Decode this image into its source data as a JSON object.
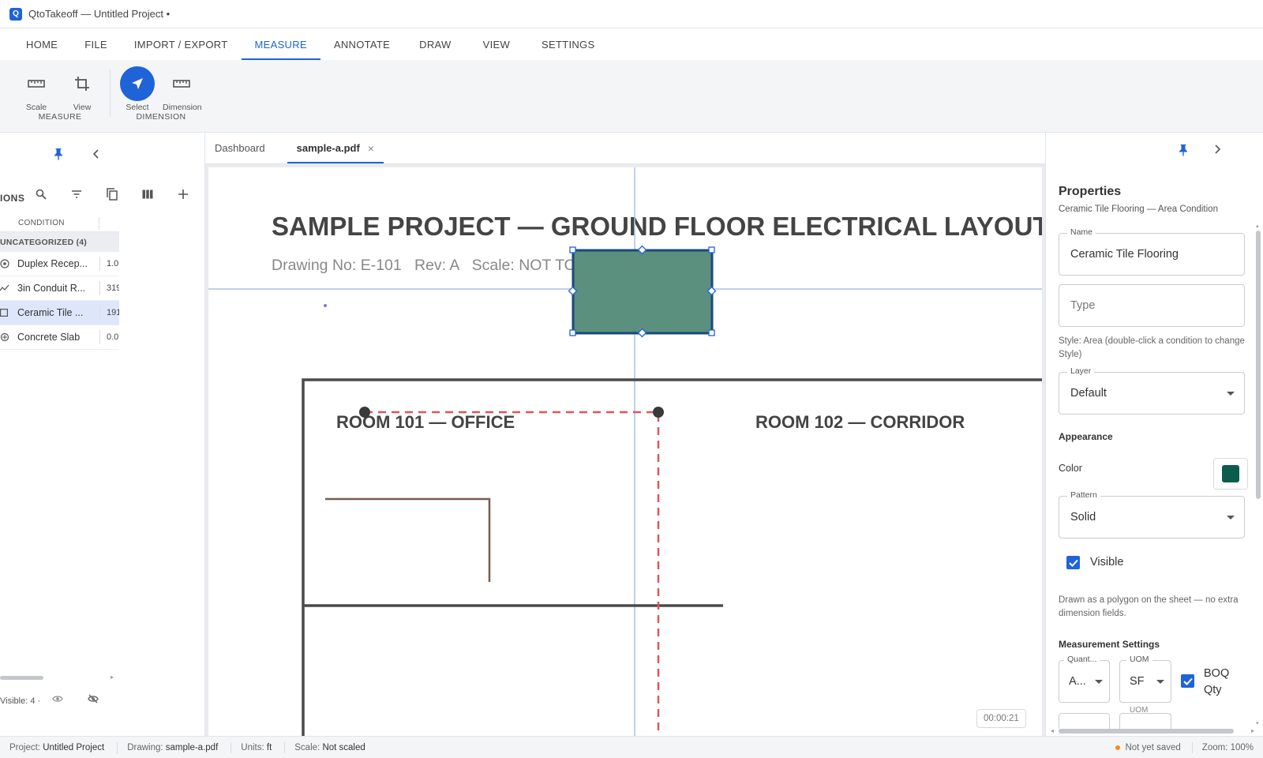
{
  "app": {
    "logo_letter": "Q",
    "window_title": "QtoTakeoff — Untitled Project •"
  },
  "ribbon_tabs": [
    {
      "label": "HOME"
    },
    {
      "label": "FILE"
    },
    {
      "label": "IMPORT / EXPORT"
    },
    {
      "label": "MEASURE",
      "active": true
    },
    {
      "label": "ANNOTATE"
    },
    {
      "label": "DRAW"
    },
    {
      "label": "VIEW"
    },
    {
      "label": "SETTINGS"
    }
  ],
  "ribbon": {
    "groups": [
      {
        "label": "MEASURE",
        "buttons": [
          {
            "label": "Scale",
            "icon": "ruler-icon"
          },
          {
            "label": "View",
            "icon": "crop-icon"
          }
        ]
      },
      {
        "label": "DIMENSION",
        "buttons": [
          {
            "label": "Select",
            "icon": "cursor-arrow-icon",
            "active": true
          },
          {
            "label": "Dimension",
            "icon": "ruler-icon"
          }
        ]
      }
    ]
  },
  "left_panel": {
    "title": "IONS",
    "table_header": "CONDITION",
    "group_label": "UNCATEGORIZED (4)",
    "rows": [
      {
        "name": "Duplex Recep...",
        "qty": "1.0",
        "icon": "count-icon"
      },
      {
        "name": "3in Conduit R...",
        "qty": "319",
        "icon": "linear-icon"
      },
      {
        "name": "Ceramic Tile ...",
        "qty": "191",
        "icon": "area-icon",
        "selected": true
      },
      {
        "name": "Concrete Slab",
        "qty": "0.0",
        "icon": "volume-icon"
      }
    ],
    "footer_text": "Visible: 4 ·"
  },
  "doc_tabs": [
    {
      "label": "Dashboard"
    },
    {
      "label": "sample-a.pdf",
      "active": true,
      "close": "×"
    }
  ],
  "sheet": {
    "title": "SAMPLE PROJECT — GROUND FLOOR ELECTRICAL LAYOUT",
    "subtitle": "Drawing No: E-101   Rev: A   Scale: NOT TO SCALE (sample)",
    "room_101": "ROOM 101 — OFFICE",
    "room_102": "ROOM 102 — CORRIDOR",
    "timer": "00:00:21",
    "area_color": "#5b8f7e",
    "dim_color": "#e05555"
  },
  "properties": {
    "title": "Properties",
    "subtitle": "Ceramic Tile Flooring — Area Condition",
    "name_label": "Name",
    "name_value": "Ceramic Tile Flooring",
    "type_placeholder": "Type",
    "style_note": "Style: Area (double-click a condition to change Style)",
    "layer_label": "Layer",
    "layer_value": "Default",
    "appearance_heading": "Appearance",
    "color_label": "Color",
    "color_value": "#0b5c4c",
    "pattern_label": "Pattern",
    "pattern_value": "Solid",
    "visible_label": "Visible",
    "polygon_note": "Drawn as a polygon on the sheet — no extra dimension fields.",
    "measurement_heading": "Measurement Settings",
    "quantity_label": "Quant...",
    "quantity_value": "A...",
    "uom_label": "UOM",
    "uom_value": "SF",
    "uom_label_2": "UOM",
    "boq_label_1": "BOQ",
    "boq_label_2": "Qty"
  },
  "status": {
    "project_label": "Project:",
    "project_value": "Untitled Project",
    "drawing_label": "Drawing:",
    "drawing_value": "sample-a.pdf",
    "units_label": "Units:",
    "units_value": "ft",
    "scale_label": "Scale:",
    "scale_value": "Not scaled",
    "save_state": "Not yet saved",
    "zoom": "Zoom: 100%"
  }
}
